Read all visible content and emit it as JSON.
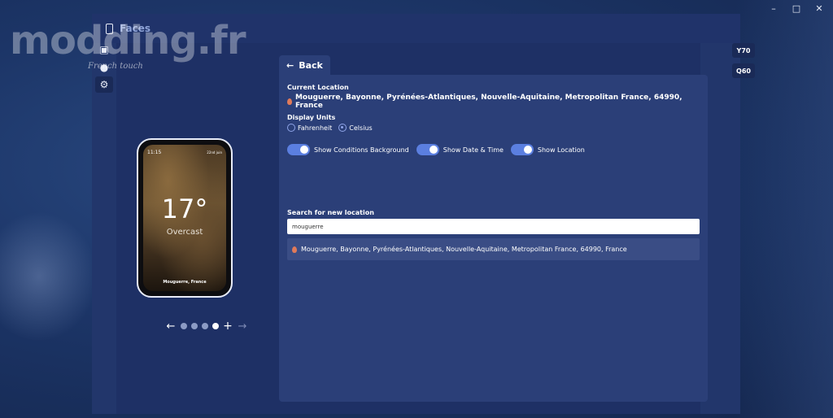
{
  "window": {
    "minimize": "–",
    "maximize": "□",
    "close": "✕"
  },
  "header": {
    "title": "Faces"
  },
  "sidebar": {
    "items": [
      {
        "icon": "image-icon",
        "glyph": "▣"
      },
      {
        "icon": "face-icon",
        "glyph": "●"
      },
      {
        "icon": "gear-icon",
        "glyph": "⚙"
      }
    ]
  },
  "preview": {
    "time": "11:15",
    "date": "22nd juin",
    "temperature": "17°",
    "condition": "Overcast",
    "location": "Mouguerre, France",
    "carousel": {
      "prev": "←",
      "next": "→",
      "add": "+",
      "dots": 4,
      "active_dot": 4
    }
  },
  "back_tab": {
    "icon": "←",
    "label": "Back"
  },
  "settings": {
    "current_location_label": "Current Location",
    "current_location_value": "Mouguerre, Bayonne, Pyrénées-Atlantiques, Nouvelle-Aquitaine, Metropolitan France, 64990, France",
    "display_units_label": "Display Units",
    "units": [
      {
        "label": "Fahrenheit",
        "checked": false
      },
      {
        "label": "Celsius",
        "checked": true
      }
    ],
    "toggles": [
      {
        "label": "Show Conditions Background",
        "on": true
      },
      {
        "label": "Show Date & Time",
        "on": true
      },
      {
        "label": "Show Location",
        "on": true
      }
    ],
    "search_label": "Search for new location",
    "search_value": "mouguerre",
    "results": [
      "Mouguerre, Bayonne, Pyrénées-Atlantiques, Nouvelle-Aquitaine, Metropolitan France, 64990, France"
    ]
  },
  "right_buttons": [
    "Y70",
    "Q60"
  ],
  "watermark": {
    "text": "modding.fr",
    "subtext": "French touch"
  }
}
